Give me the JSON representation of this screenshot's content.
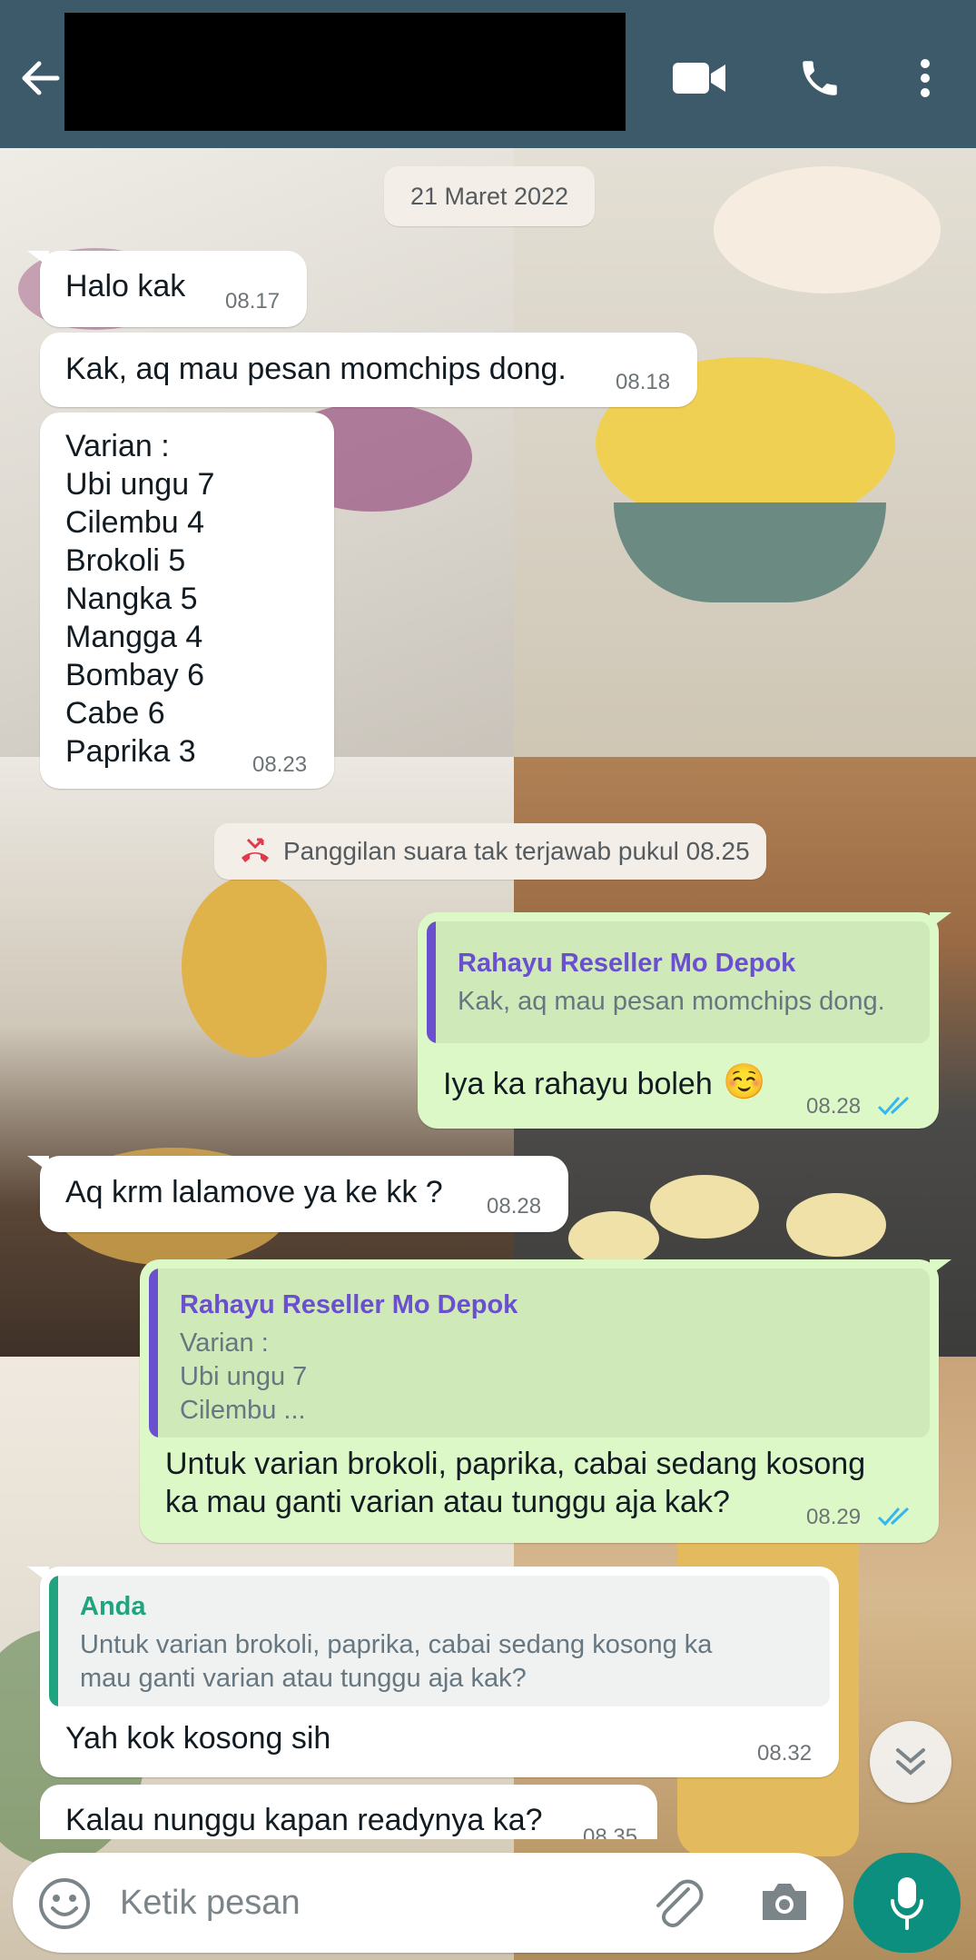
{
  "header": {
    "back_icon": "arrow-left-icon",
    "video_icon": "video-call-icon",
    "call_icon": "phone-icon",
    "menu_icon": "more-vertical-icon",
    "bar_color": "#3d5a6b"
  },
  "date_separator": "21 Maret 2022",
  "messages": [
    {
      "direction": "in",
      "text": "Halo kak",
      "time": "08.17"
    },
    {
      "direction": "in",
      "text": "Kak, aq mau pesan momchips dong.",
      "time": "08.18"
    },
    {
      "direction": "in",
      "lines": [
        "Varian :",
        "Ubi ungu 7",
        "Cilembu 4",
        "Brokoli 5",
        "Nangka 5",
        "Mangga 4",
        "Bombay 6",
        "Cabe 6",
        "Paprika 3"
      ],
      "time": "08.23"
    },
    {
      "direction": "out",
      "quote": {
        "name": "Rahayu Reseller Mo Depok",
        "text": "Kak, aq mau pesan momchips dong."
      },
      "text": "Iya ka rahayu boleh",
      "emoji": "☺️",
      "time": "08.28",
      "status": "read"
    },
    {
      "direction": "in",
      "text": "Aq krm lalamove ya ke kk ?",
      "time": "08.28"
    },
    {
      "direction": "out",
      "quote": {
        "name": "Rahayu Reseller Mo Depok",
        "lines": [
          "Varian :",
          "Ubi ungu 7",
          "Cilembu ..."
        ]
      },
      "lines": [
        "Untuk varian brokoli, paprika, cabai sedang kosong",
        "ka mau ganti varian atau tunggu aja kak?"
      ],
      "time": "08.29",
      "status": "read"
    },
    {
      "direction": "in",
      "quote": {
        "name": "Anda",
        "lines": [
          "Untuk varian brokoli, paprika, cabai sedang kosong ka",
          "mau ganti varian atau tunggu aja kak?"
        ]
      },
      "text": "Yah kok kosong sih",
      "time": "08.32"
    },
    {
      "direction": "in",
      "text": "Kalau nunggu kapan readynya ka?",
      "time": "08.35"
    }
  ],
  "missed_call": {
    "icon": "missed-call-icon",
    "text": "Panggilan suara tak terjawab pukul 08.25"
  },
  "scroll_down_icon": "double-chevron-down-icon",
  "composer": {
    "emoji_icon": "emoji-icon",
    "placeholder": "Ketik pesan",
    "attach_icon": "paperclip-icon",
    "camera_icon": "camera-icon",
    "mic_icon": "microphone-icon"
  },
  "colors": {
    "incoming_bubble": "#ffffff",
    "outgoing_bubble": "#dcf8c6",
    "read_tick": "#34b7f1",
    "quote_other": "#6a4fcf",
    "quote_self": "#1fa47f",
    "mic_button": "#0d8f7f",
    "missed_call": "#e0394b"
  }
}
